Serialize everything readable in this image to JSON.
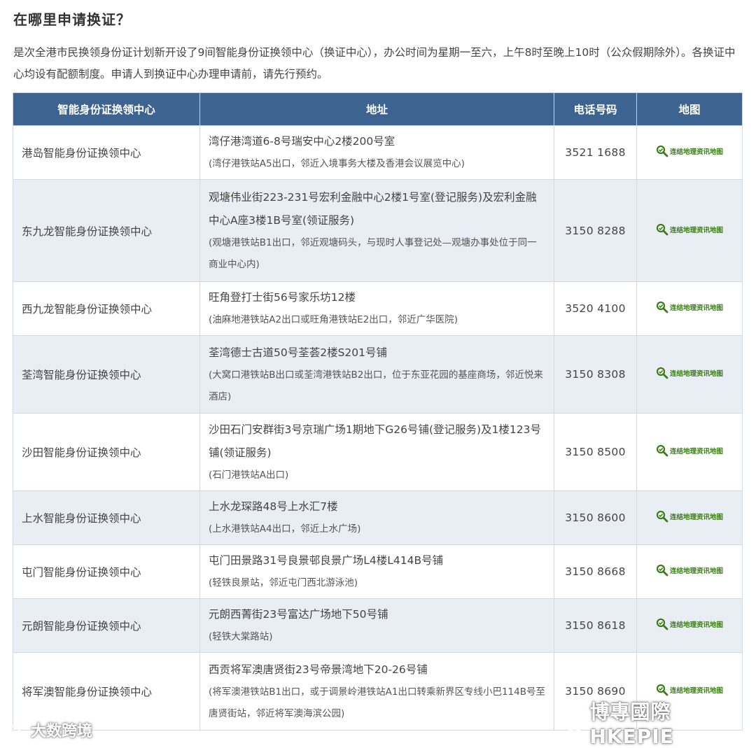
{
  "heading": "在哪里申请换证？",
  "intro": "是次全港市民换领身份证计划新开设了9间智能身份证换领中心（换证中心），办公时间为星期一至六，上午8时至晚上10时（公众假期除外）。各换证中心均设有配额制度。申请人到换证中心办理申请前，请先行预约。",
  "table": {
    "headers": [
      "智能身份证换领中心",
      "地址",
      "电话号码",
      "地图"
    ],
    "map_link_label": "连结地理资讯地图",
    "rows": [
      {
        "name": "港岛智能身份证换领中心",
        "address": "湾仔港湾道6-8号瑞安中心2楼200号室",
        "note": "(湾仔港铁站A5出口，邻近入境事务大楼及香港会议展览中心)",
        "phone": "3521 1688"
      },
      {
        "name": "东九龙智能身份证换领中心",
        "address": "观塘伟业街223-231号宏利金融中心2楼1号室(登记服务)及宏利金融中心A座3楼1B号室(领证服务)",
        "note": "(观塘港铁站B1出口，邻近观塘码头，与现时人事登记处—观塘办事处位于同一商业中心内)",
        "phone": "3150 8288"
      },
      {
        "name": "西九龙智能身份证换领中心",
        "address": "旺角登打士街56号家乐坊12楼",
        "note": "(油麻地港铁站A2出口或旺角港铁站E2出口，邻近广华医院)",
        "phone": "3520 4100"
      },
      {
        "name": "荃湾智能身份证换领中心",
        "address": "荃湾德士古道50号荃荟2楼S201号铺",
        "note": "(大窝口港铁站B出口或荃湾港铁站B2出口，位于东亚花园的基座商场，邻近悦来酒店)",
        "phone": "3150 8308"
      },
      {
        "name": "沙田智能身份证换领中心",
        "address": "沙田石门安群街3号京瑞广场1期地下G26号铺(登记服务)及1楼123号铺(领证服务)",
        "note": "(石门港铁站A出口)",
        "phone": "3150 8500"
      },
      {
        "name": "上水智能身份证换领中心",
        "address": "上水龙琛路48号上水汇7楼",
        "note": "(上水港铁站A4出口，邻近上水广场)",
        "phone": "3150 8600"
      },
      {
        "name": "屯门智能身份证换领中心",
        "address": "屯门田景路31号良景邨良景广场L4楼L414B号铺",
        "note": "(轻铁良景站，邻近屯门西北游泳池)",
        "phone": "3150 8668"
      },
      {
        "name": "元朗智能身份证换领中心",
        "address": "元朗西菁街23号富达广场地下50号铺",
        "note": "(轻铁大棠路站)",
        "phone": "3150 8618"
      },
      {
        "name": "将军澳智能身份证换领中心",
        "address": "西贡将军澳唐贤街23号帝景湾地下20-26号铺",
        "note": "(将军澳港铁站B1出口，或于调景岭港铁站A1出口转乘新界区专线小巴114B号至唐贤街站，邻近将军澳海滨公园)",
        "phone": "3150 8690"
      }
    ]
  },
  "watermarks": {
    "left": "大数跨境",
    "right": "博專國際 HKEPIE",
    "left_icon": "weibo-logo-icon",
    "right_icon": "wechat-logo-icon"
  },
  "colors": {
    "header_bg": "#3d6391",
    "row_alt_bg": "#e9edf4",
    "map_link": "#3a7d16"
  }
}
